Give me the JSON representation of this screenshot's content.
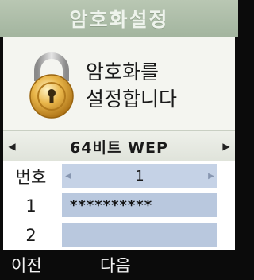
{
  "screen": {
    "title": "암호화설정"
  },
  "hero": {
    "icon": "padlock-icon",
    "message_line1": "암호화를",
    "message_line2": "설정합니다"
  },
  "security_type": {
    "value": "64비트 WEP",
    "left_arrow": "◀",
    "right_arrow": "▶"
  },
  "key_table": {
    "header_label": "번호",
    "selected_index": "1",
    "rows": [
      {
        "label": "1",
        "value": "**********"
      },
      {
        "label": "2",
        "value": ""
      }
    ]
  },
  "softkeys": {
    "left": "이전",
    "center": "다음"
  },
  "colors": {
    "title_bar": "#a3b59f",
    "field_bg": "#b9c8de",
    "lock_gold": "#d9a236"
  }
}
